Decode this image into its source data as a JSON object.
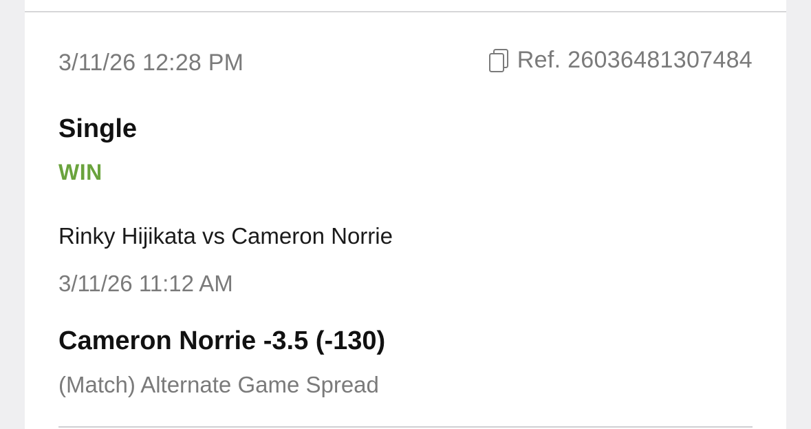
{
  "bet": {
    "placed_time": "3/11/26 12:28 PM",
    "ref_label": "Ref. 26036481307484",
    "type": "Single",
    "status": "WIN",
    "event": "Rinky Hijikata vs Cameron Norrie",
    "event_time": "3/11/26 11:12 AM",
    "selection": "Cameron Norrie -3.5 (-130)",
    "market": "(Match) Alternate Game Spread"
  },
  "icons": {
    "copy": "copy-icon"
  },
  "colors": {
    "win": "#6aa33d",
    "muted_text": "#7a7a7a",
    "page_background": "#efeff1"
  }
}
